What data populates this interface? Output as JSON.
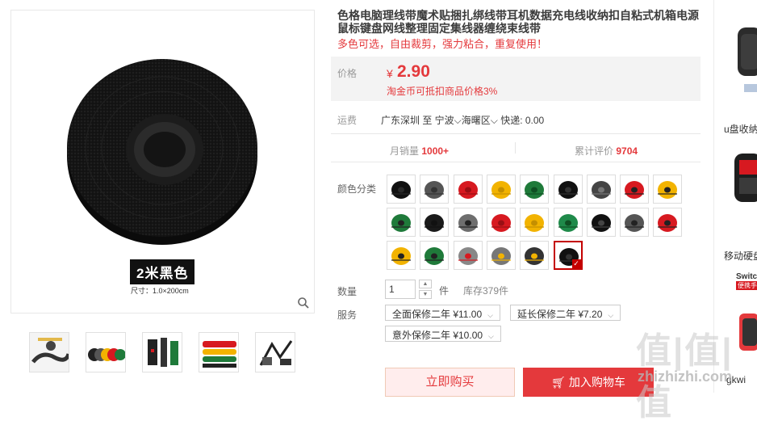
{
  "product": {
    "title": "色格电脑理线带魔术贴捆扎绑线带耳机数据充电线收纳扣自粘式机箱电源鼠标键盘网线整理固定集线器缠绕束线带",
    "subtitle": "多色可选，自由裁剪，强力粘合，重复使用！",
    "image_label": "2米黑色",
    "image_caption": "尺寸：1.0×200cm"
  },
  "price": {
    "label": "价格",
    "symbol": "¥",
    "value": "2.90",
    "note": "淘金币可抵扣商品价格3%"
  },
  "shipping": {
    "label": "运费",
    "text": "广东深圳  至 宁波⌵海曙区⌵ 快递: 0.00"
  },
  "stats": {
    "monthly_sales_label": "月销量",
    "monthly_sales": "1000+",
    "reviews_label": "累计评价",
    "reviews": "9704"
  },
  "options": {
    "color_label": "颜色分类",
    "swatches": [
      {
        "color": "#111111",
        "band": "#2a2a2a"
      },
      {
        "color": "#555555",
        "band": "#333"
      },
      {
        "color": "#d71920",
        "band": "#9a0f14"
      },
      {
        "color": "#f2b300",
        "band": "#c48f00"
      },
      {
        "color": "#1f7a3a",
        "band": "#0f4f23"
      },
      {
        "color": "#111111",
        "band": "#333"
      },
      {
        "color": "#444444",
        "band": "#777"
      },
      {
        "color": "#d71920",
        "band": "#222"
      },
      {
        "color": "#f2b300",
        "band": "#222"
      },
      {
        "color": "#1f7a3a",
        "band": "#222"
      },
      {
        "color": "#1a1a1a",
        "band": "#111"
      },
      {
        "color": "#6e6e6e",
        "band": "#222"
      },
      {
        "color": "#d71920",
        "band": "#9a0f14"
      },
      {
        "color": "#f2b300",
        "band": "#c48f00"
      },
      {
        "color": "#1f8a4a",
        "band": "#0f4f23"
      },
      {
        "color": "#111111",
        "band": "#444"
      },
      {
        "color": "#555555",
        "band": "#222"
      },
      {
        "color": "#d71920",
        "band": "#222"
      },
      {
        "color": "#f2b300",
        "band": "#222"
      },
      {
        "color": "#1f7a3a",
        "band": "#222"
      },
      {
        "color": "#888888",
        "band": "#d71920"
      },
      {
        "color": "#777777",
        "band": "#f2b300"
      },
      {
        "color": "#333333",
        "band": "#f2b300"
      },
      {
        "color": "#111111",
        "band": "#333",
        "selected": true
      }
    ],
    "qty_label": "数量",
    "qty_value": "1",
    "qty_unit": "件",
    "stock": "库存379件",
    "service_label": "服务",
    "services": [
      "全面保修二年 ¥11.00",
      "延长保修二年 ¥7.20",
      "意外保修二年 ¥10.00"
    ]
  },
  "actions": {
    "buy_now": "立即购买",
    "add_cart": "加入购物车"
  },
  "sidebar": {
    "item1": "u盘收纳",
    "item2": "移动硬盘",
    "item3_top": "Switc",
    "item3_sub": "便携手",
    "item4": "gkwi"
  },
  "watermark": {
    "text": "值|值|值",
    "url": "zhizhizhi.com"
  },
  "colors": {
    "accent": "#e4393c",
    "selected_border": "#c40000"
  }
}
